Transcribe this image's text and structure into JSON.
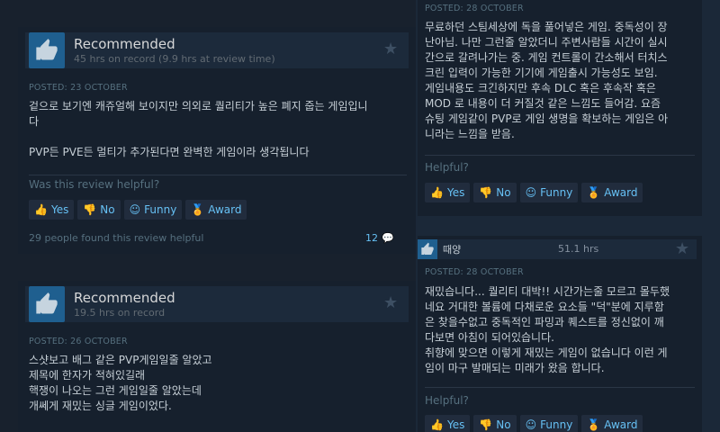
{
  "left": {
    "review1": {
      "rec_label": "Recommended",
      "hours": "45 hrs on record (9.9 hrs at review time)",
      "posted": "POSTED: 23 OCTOBER",
      "text": "겉으로 보기엔 캐쥬얼해 보이지만 의외로 퀄리티가 높은 폐지 줍는 게임입니\n다\n\nPVP든 PVE든 멀티가 추가된다면 완벽한 게임이라 생각됩니다",
      "helpful_q": "Was this review helpful?",
      "yes": "Yes",
      "no": "No",
      "funny": "Funny",
      "award": "Award",
      "found_helpful": "29 people found this review helpful",
      "comments": "12"
    },
    "review2": {
      "rec_label": "Recommended",
      "hours": "19.5 hrs on record",
      "posted": "POSTED: 26 OCTOBER",
      "text": "스샷보고 배그 같은 PVP게임일줄 알았고\n제목에 한자가 적혀있길래\n핵쟁이 나오는 그런 게임일줄 알았는데\n개쎄게 재밌는 싱글 게임이었다."
    }
  },
  "right": {
    "review1": {
      "posted": "POSTED: 28 OCTOBER",
      "text": "무료하던 스팀세상에 독을 풀어넣은 게임. 중독성이 장\n난아님. 나만 그런줄 알았더니 주변사람들 시간이 실시\n간으로 갈려나가는 중. 게임 컨트롤이 간소해서 터치스\n크린 입력이 가능한 기기에 게임출시 가능성도 보임.\n게임내용도 크긴하지만 후속 DLC 혹은 후속작 혹은\nMOD 로 내용이 더 커질것 같은 느낌도 들어감. 요즘\n슈팅 게임같이 PVP로 게임 생명을 확보하는 게임은 아\n니라는 느낌을 받음.",
      "helpful_q": "Helpful?",
      "yes": "Yes",
      "no": "No",
      "funny": "Funny",
      "award": "Award"
    },
    "review2": {
      "name": "때양",
      "hours": "51.1 hrs",
      "posted": "POSTED: 28 OCTOBER",
      "text": "재밌습니다... 퀄리티 대박!! 시간가는줄 모르고 몰두했\n네요 거대한 볼륨에 다채로운 요소들 \"덕\"분에 지루함\n은 찾을수없고 중독적인 파밍과 퀘스트를 정신없이 깨\n다보면 아침이 되어있습니다.\n취향에 맞으면 이렇게 재밌는 게임이 없습니다 이런 게\n임이 마구 발매되는 미래가 왔음 합니다.",
      "helpful_q": "Helpful?",
      "yes": "Yes",
      "no": "No",
      "funny": "Funny",
      "award": "Award"
    }
  },
  "icons": {
    "thumbs_up": "thumbs-up-icon",
    "thumbs_down": "thumbs-down-icon",
    "smiley": "smiley-icon",
    "award": "award-icon",
    "star": "star-icon",
    "comment": "comment-icon"
  },
  "colors": {
    "accent": "#66c0f4",
    "award": "#e8b820",
    "thumb_bg": "#1f5f8f"
  }
}
